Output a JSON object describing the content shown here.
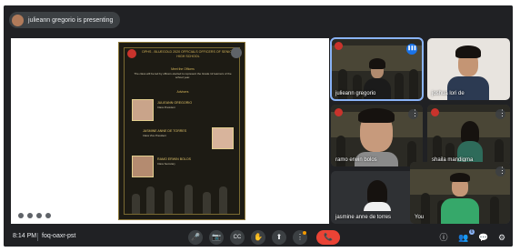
{
  "topbar": {
    "presenter_label": "julieann gregorio is presenting"
  },
  "slide": {
    "heading": "DPHS - BLUEGOLD 2020 OFFICIALS OFFICERS OF SENIOR HIGH SCHOOL",
    "subheading": "Meet the Officers",
    "body": "The class will be led by officers elected to represent the Grade 12 learners of the school year.",
    "section_label": "Advisers",
    "people": [
      {
        "name": "JULIEANN GREGORIO",
        "desc": "Class President"
      },
      {
        "name": "JASMINE ANNE DE TORRES",
        "desc": "Class Vice President"
      },
      {
        "name": "RAMO ERWIN BOLOS",
        "desc": "Class Secretary"
      }
    ]
  },
  "participants": [
    {
      "name": "julieann gregorio"
    },
    {
      "name": "joshua lori de"
    },
    {
      "name": "ramo erwin bolos"
    },
    {
      "name": "shaila mandigma"
    },
    {
      "name": "jasmine anne de torres"
    },
    {
      "name": "You"
    }
  ],
  "bottombar": {
    "time": "8:14 PM",
    "meeting_code": "foq-oaxr-pst"
  },
  "controls": {
    "mic": "🎤",
    "camera": "📷",
    "captions": "CC",
    "raise_hand": "✋",
    "present": "⬆",
    "more": "⋮",
    "hangup": "📞"
  },
  "right_controls": {
    "info": "ⓘ",
    "people": "👥",
    "chat": "💬",
    "activities": "⚙",
    "people_count": "6"
  },
  "colors": {
    "background": "#202124",
    "tile": "#3c4043",
    "active": "#8ab4f8",
    "hangup": "#ea4335",
    "slide_gold": "#d4b45a"
  }
}
